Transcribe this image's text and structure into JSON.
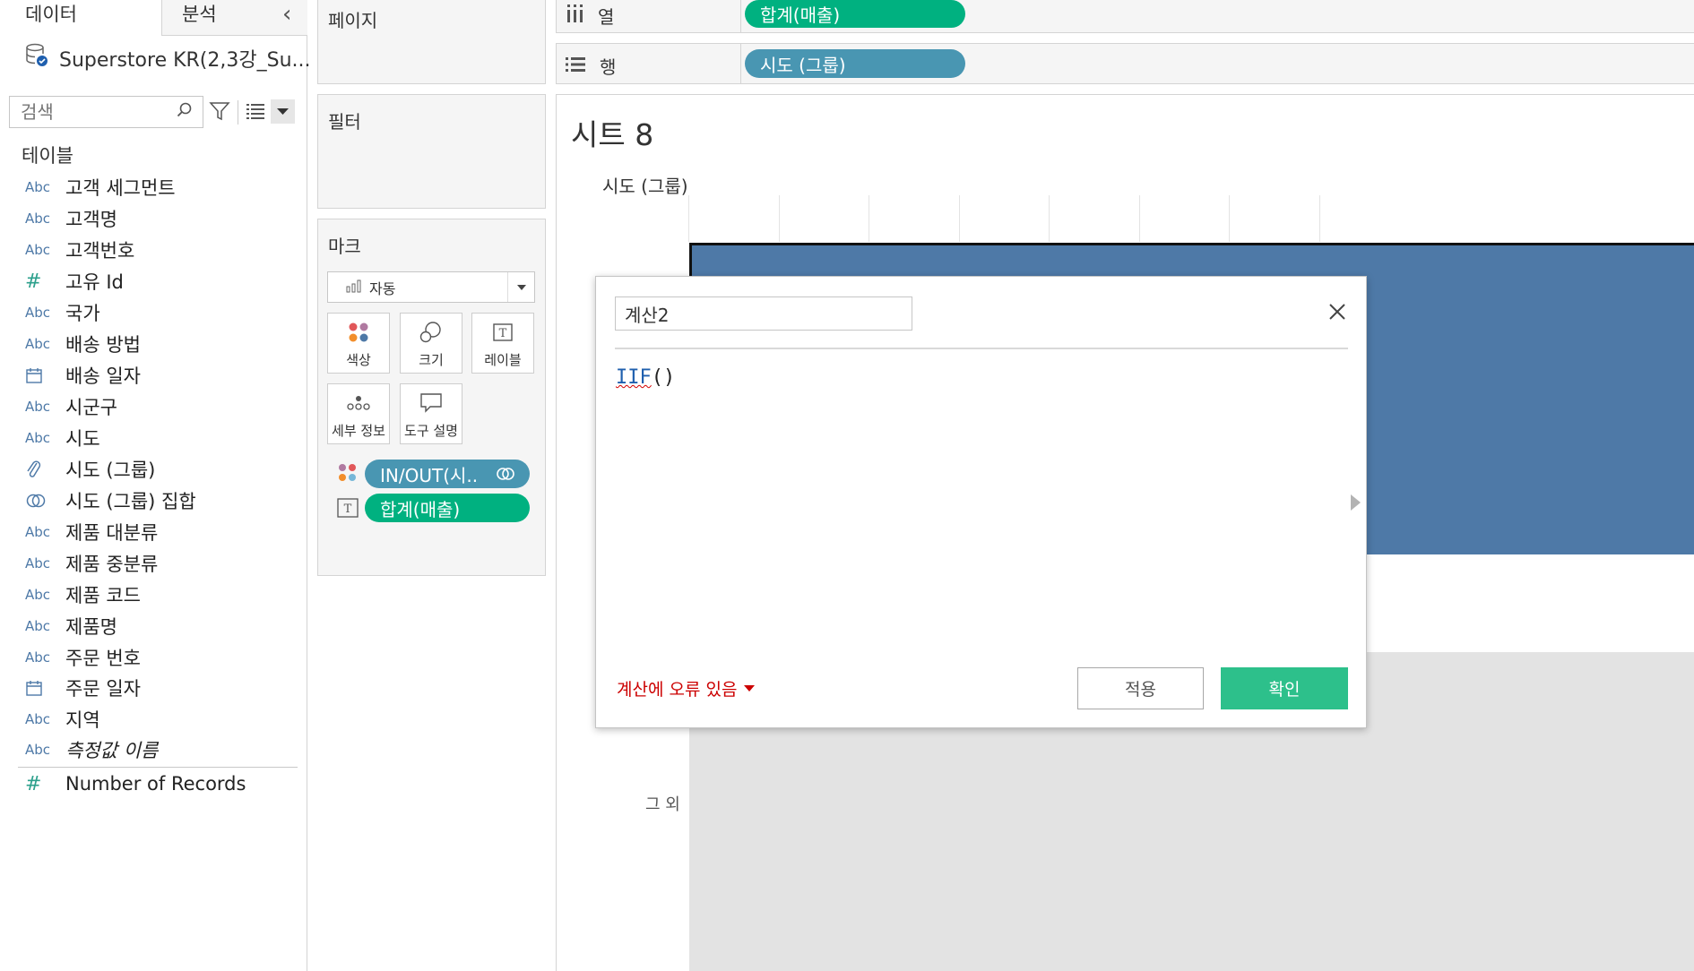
{
  "data_pane": {
    "tab_data": "데이터",
    "tab_analysis": "분석",
    "datasource": "Superstore KR(2,3강_Su...",
    "search_placeholder": "검색",
    "tables_heading": "테이블",
    "fields": [
      {
        "type": "Abc",
        "label": "고객 세그먼트"
      },
      {
        "type": "Abc",
        "label": "고객명"
      },
      {
        "type": "Abc",
        "label": "고객번호"
      },
      {
        "type": "#",
        "label": "고유 Id"
      },
      {
        "type": "Abc",
        "label": "국가"
      },
      {
        "type": "Abc",
        "label": "배송 방법"
      },
      {
        "type": "date",
        "label": "배송 일자"
      },
      {
        "type": "Abc",
        "label": "시군구"
      },
      {
        "type": "Abc",
        "label": "시도"
      },
      {
        "type": "paperclip",
        "label": "시도 (그룹)"
      },
      {
        "type": "set",
        "label": "시도 (그룹) 집합"
      },
      {
        "type": "Abc",
        "label": "제품 대분류"
      },
      {
        "type": "Abc",
        "label": "제품 중분류"
      },
      {
        "type": "Abc",
        "label": "제품 코드"
      },
      {
        "type": "Abc",
        "label": "제품명"
      },
      {
        "type": "Abc",
        "label": "주문 번호"
      },
      {
        "type": "date",
        "label": "주문 일자"
      },
      {
        "type": "Abc",
        "label": "지역"
      },
      {
        "type": "Abc",
        "label": "측정값 이름"
      }
    ],
    "measure_field": {
      "type": "#",
      "label": "Number of Records"
    }
  },
  "cards": {
    "pages_title": "페이지",
    "filters_title": "필터",
    "marks_title": "마크",
    "marks_type": "자동",
    "mark_buttons": {
      "color": "색상",
      "size": "크기",
      "label": "레이블",
      "detail": "세부 정보",
      "tooltip": "도구 설명"
    },
    "mark_pills": {
      "color_pill": "IN/OUT(시..",
      "label_pill": "합계(매출)"
    }
  },
  "shelves": {
    "columns_label": "열",
    "columns_pill": "합계(매출)",
    "rows_label": "행",
    "rows_pill": "시도 (그룹)"
  },
  "view": {
    "sheet_title": "시트 8",
    "row_header": "시도 (그룹)",
    "bottom_partial_label": "그 외"
  },
  "calc_dialog": {
    "name_value": "계산2",
    "formula_fn": "IIF",
    "formula_rest": "()",
    "error_text": "계산에 오류 있음",
    "apply_label": "적용",
    "ok_label": "확인"
  },
  "colors": {
    "green_pill": "#00b180",
    "blue_pill": "#4996b2",
    "bar": "#4e79a7",
    "ok_button": "#2dc08b",
    "error_text": "#cc0000"
  }
}
